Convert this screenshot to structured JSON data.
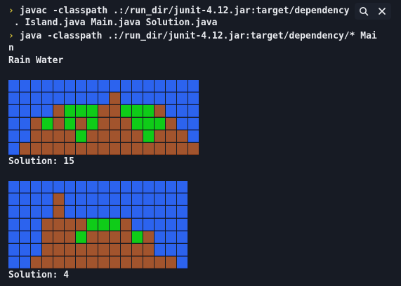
{
  "terminal": {
    "prompt_glyph": "›",
    "commands": [
      "javac -classpath .:/run_dir/junit-4.12.jar:target/dependency",
      " . Island.java Main.java Solution.java",
      "java -classpath .:/run_dir/junit-4.12.jar:target/dependency/* Mai",
      "n"
    ],
    "heading": "Rain Water",
    "solution1": "Solution: 15",
    "solution2": "Solution: 4"
  },
  "toolbar": {
    "search_icon": "search-icon",
    "close_icon": "close-icon"
  },
  "colors": {
    "background": "#171b24",
    "text": "#e8eaee",
    "prompt": "#d6c23a",
    "water": "#2c63ee",
    "land": "#a2542d",
    "trapped_water": "#0fcc18"
  },
  "grids": [
    {
      "cols": 17,
      "rows": [
        "bbbbbbbbbbbbbbbbb",
        "bbbbbbbbbdbbbbbbb",
        "bbbbdgggddgggdbbb",
        "bbdgdgdgdddgggdbb",
        "bbddddgdddddgdddb",
        "bddddddddddddddddb"
      ]
    },
    {
      "cols": 16,
      "rows": [
        "bbbbbbbbbbbbbbbb",
        "bbbbdbbbbbbbbbbb",
        "bbbbdbbbbbbbbbbb",
        "bbbddddgggdbbbbb",
        "bbbdddgddddgdbbb",
        "bbbddddddddddbbb",
        "bbdddddddddddddb"
      ]
    }
  ]
}
